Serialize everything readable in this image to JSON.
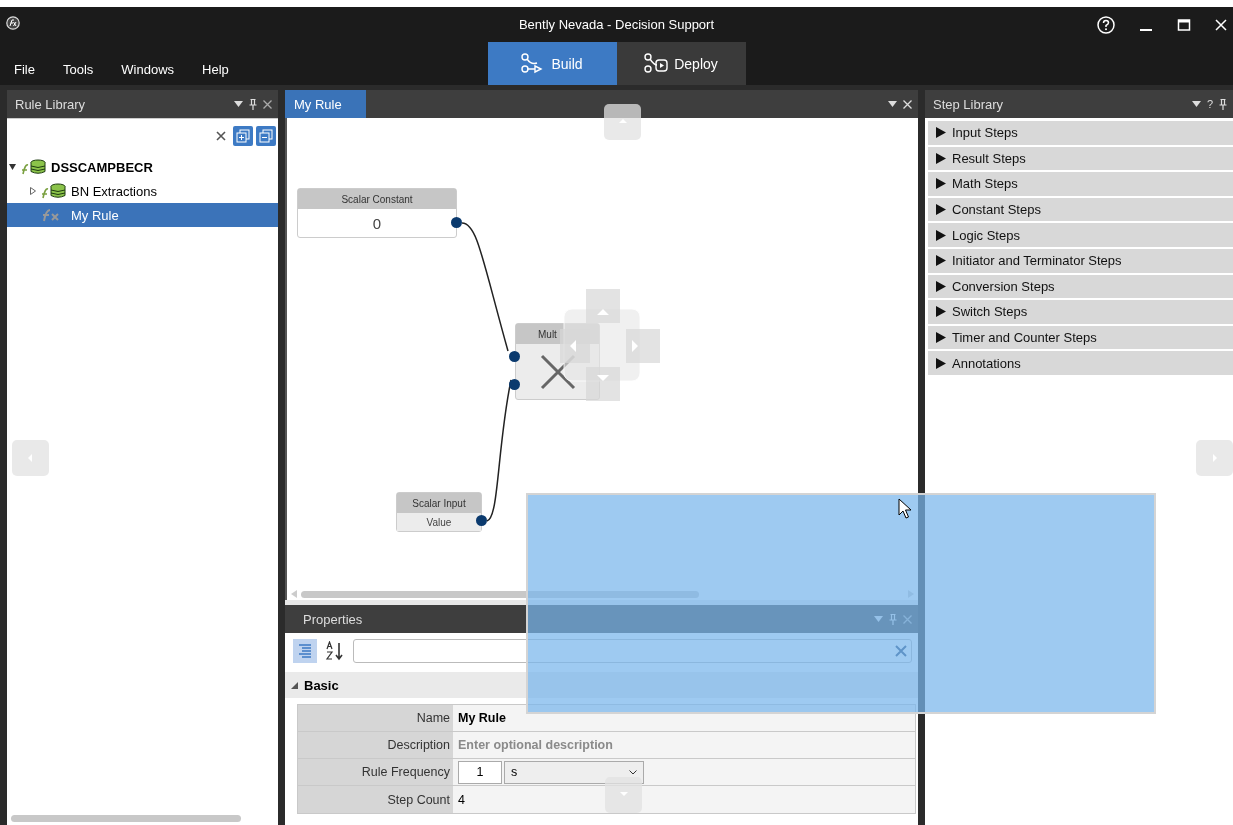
{
  "window": {
    "title": "Bently Nevada - Decision Support"
  },
  "menu": [
    "File",
    "Tools",
    "Windows",
    "Help"
  ],
  "modes": [
    {
      "label": "Build",
      "kind": "build",
      "selected": true
    },
    {
      "label": "Deploy",
      "kind": "deploy",
      "selected": false
    }
  ],
  "rule_library": {
    "title": "Rule Library",
    "tree": [
      {
        "label": "DSSCAMPBECR",
        "kind": "database",
        "expanded": true,
        "selected": false,
        "children": [
          {
            "label": "BN Extractions",
            "kind": "database",
            "expanded": false,
            "selected": false
          },
          {
            "label": "My Rule",
            "kind": "rule",
            "selected": true
          }
        ]
      }
    ]
  },
  "document_tabs": [
    {
      "label": "My Rule",
      "selected": true
    }
  ],
  "canvas": {
    "nodes": [
      {
        "kind": "constant",
        "title": "Scalar Constant",
        "value": "0"
      },
      {
        "kind": "operator",
        "title": "Mult"
      },
      {
        "kind": "input",
        "title": "Scalar Input",
        "value": "Value"
      }
    ]
  },
  "properties": {
    "title": "Properties",
    "group": {
      "label": "Basic",
      "expanded": true
    },
    "rows": [
      {
        "label": "Name",
        "kind": "text",
        "value": "My Rule"
      },
      {
        "label": "Description",
        "kind": "placeholder",
        "placeholder": "Enter optional description"
      },
      {
        "label": "Rule Frequency",
        "kind": "frequency",
        "value": "1",
        "unit": "s"
      },
      {
        "label": "Step Count",
        "kind": "plain",
        "value": "4"
      }
    ]
  },
  "step_library": {
    "title": "Step Library",
    "help_button": "?",
    "categories": [
      {
        "label": "Input Steps",
        "expanded": false
      },
      {
        "label": "Result Steps",
        "expanded": false
      },
      {
        "label": "Math Steps",
        "expanded": false
      },
      {
        "label": "Constant Steps",
        "expanded": false
      },
      {
        "label": "Logic Steps",
        "expanded": false
      },
      {
        "label": "Initiator and Terminator Steps",
        "expanded": false
      },
      {
        "label": "Conversion Steps",
        "expanded": false
      },
      {
        "label": "Switch Steps",
        "expanded": false
      },
      {
        "label": "Timer and Counter Steps",
        "expanded": false
      },
      {
        "label": "Annotations",
        "expanded": false
      }
    ]
  }
}
